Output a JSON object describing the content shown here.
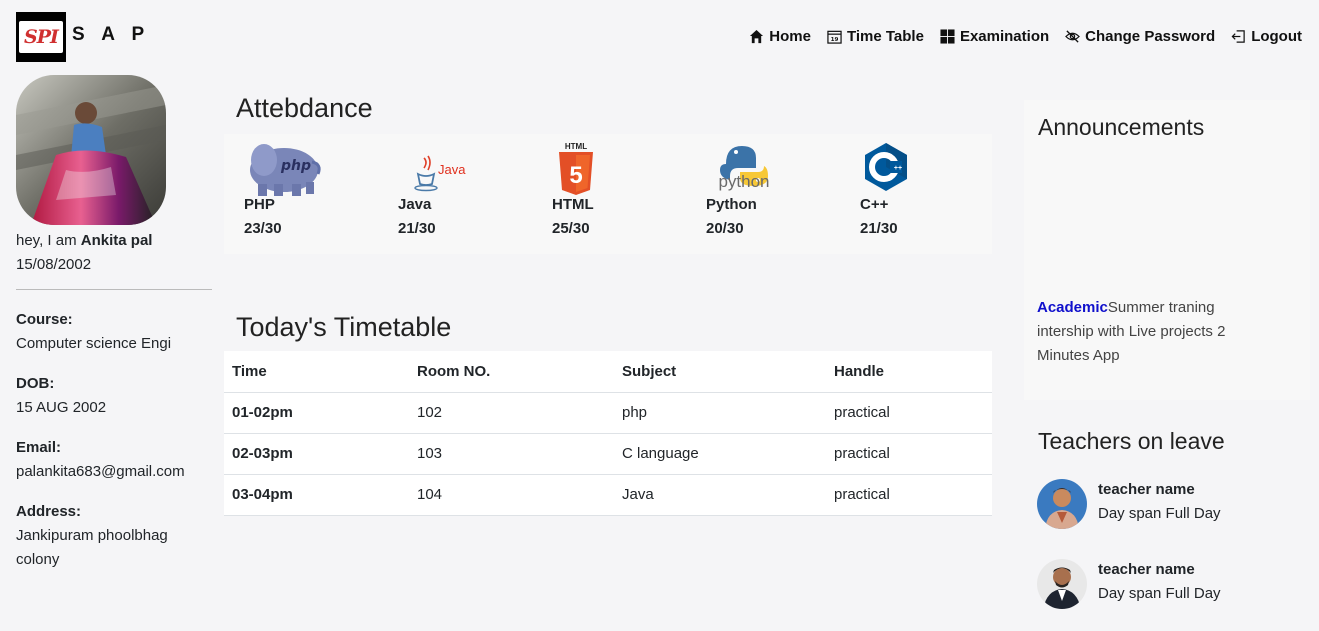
{
  "brand": {
    "logo_text": "SPI",
    "name": "S A P"
  },
  "nav": [
    {
      "label": "Home",
      "icon": "home-icon"
    },
    {
      "label": "Time Table",
      "icon": "calendar-icon"
    },
    {
      "label": "Examination",
      "icon": "grid-icon"
    },
    {
      "label": "Change Password",
      "icon": "eye-slash-icon"
    },
    {
      "label": "Logout",
      "icon": "logout-icon"
    }
  ],
  "profile": {
    "greeting": "hey, I am",
    "name": "Ankita pal",
    "dob_short": "15/08/2002",
    "fields": [
      {
        "label": "Course:",
        "value": "Computer science Engi"
      },
      {
        "label": "DOB:",
        "value": "15 AUG 2002"
      },
      {
        "label": "Email:",
        "value": "palankita683@gmail.com"
      },
      {
        "label": "Address:",
        "value": "Jankipuram phoolbhag colony"
      }
    ]
  },
  "attendance": {
    "title": "Attebdance",
    "subjects": [
      {
        "name": "PHP",
        "score": "23/30",
        "icon": "php-icon"
      },
      {
        "name": "Java",
        "score": "21/30",
        "icon": "java-icon"
      },
      {
        "name": "HTML",
        "score": "25/30",
        "icon": "html5-icon"
      },
      {
        "name": "Python",
        "score": "20/30",
        "icon": "python-icon"
      },
      {
        "name": "C++",
        "score": "21/30",
        "icon": "cpp-icon"
      }
    ]
  },
  "timetable": {
    "title": "Today's Timetable",
    "headers": [
      "Time",
      "Room NO.",
      "Subject",
      "Handle"
    ],
    "rows": [
      [
        "01-02pm",
        "102",
        "php",
        "practical"
      ],
      [
        "02-03pm",
        "103",
        "C language",
        "practical"
      ],
      [
        "03-04pm",
        "104",
        "Java",
        "practical"
      ]
    ]
  },
  "announcements": {
    "title": "Announcements",
    "tag": "Academic",
    "text": "Summer traning intership with Live projects 2 Minutes App"
  },
  "leave": {
    "title": "Teachers on leave",
    "teachers": [
      {
        "name": "teacher name",
        "span": "Day span Full Day"
      },
      {
        "name": "teacher name",
        "span": "Day span Full Day"
      }
    ]
  },
  "colors": {
    "accent_link": "#1010cc",
    "background": "#f5f5f7"
  }
}
